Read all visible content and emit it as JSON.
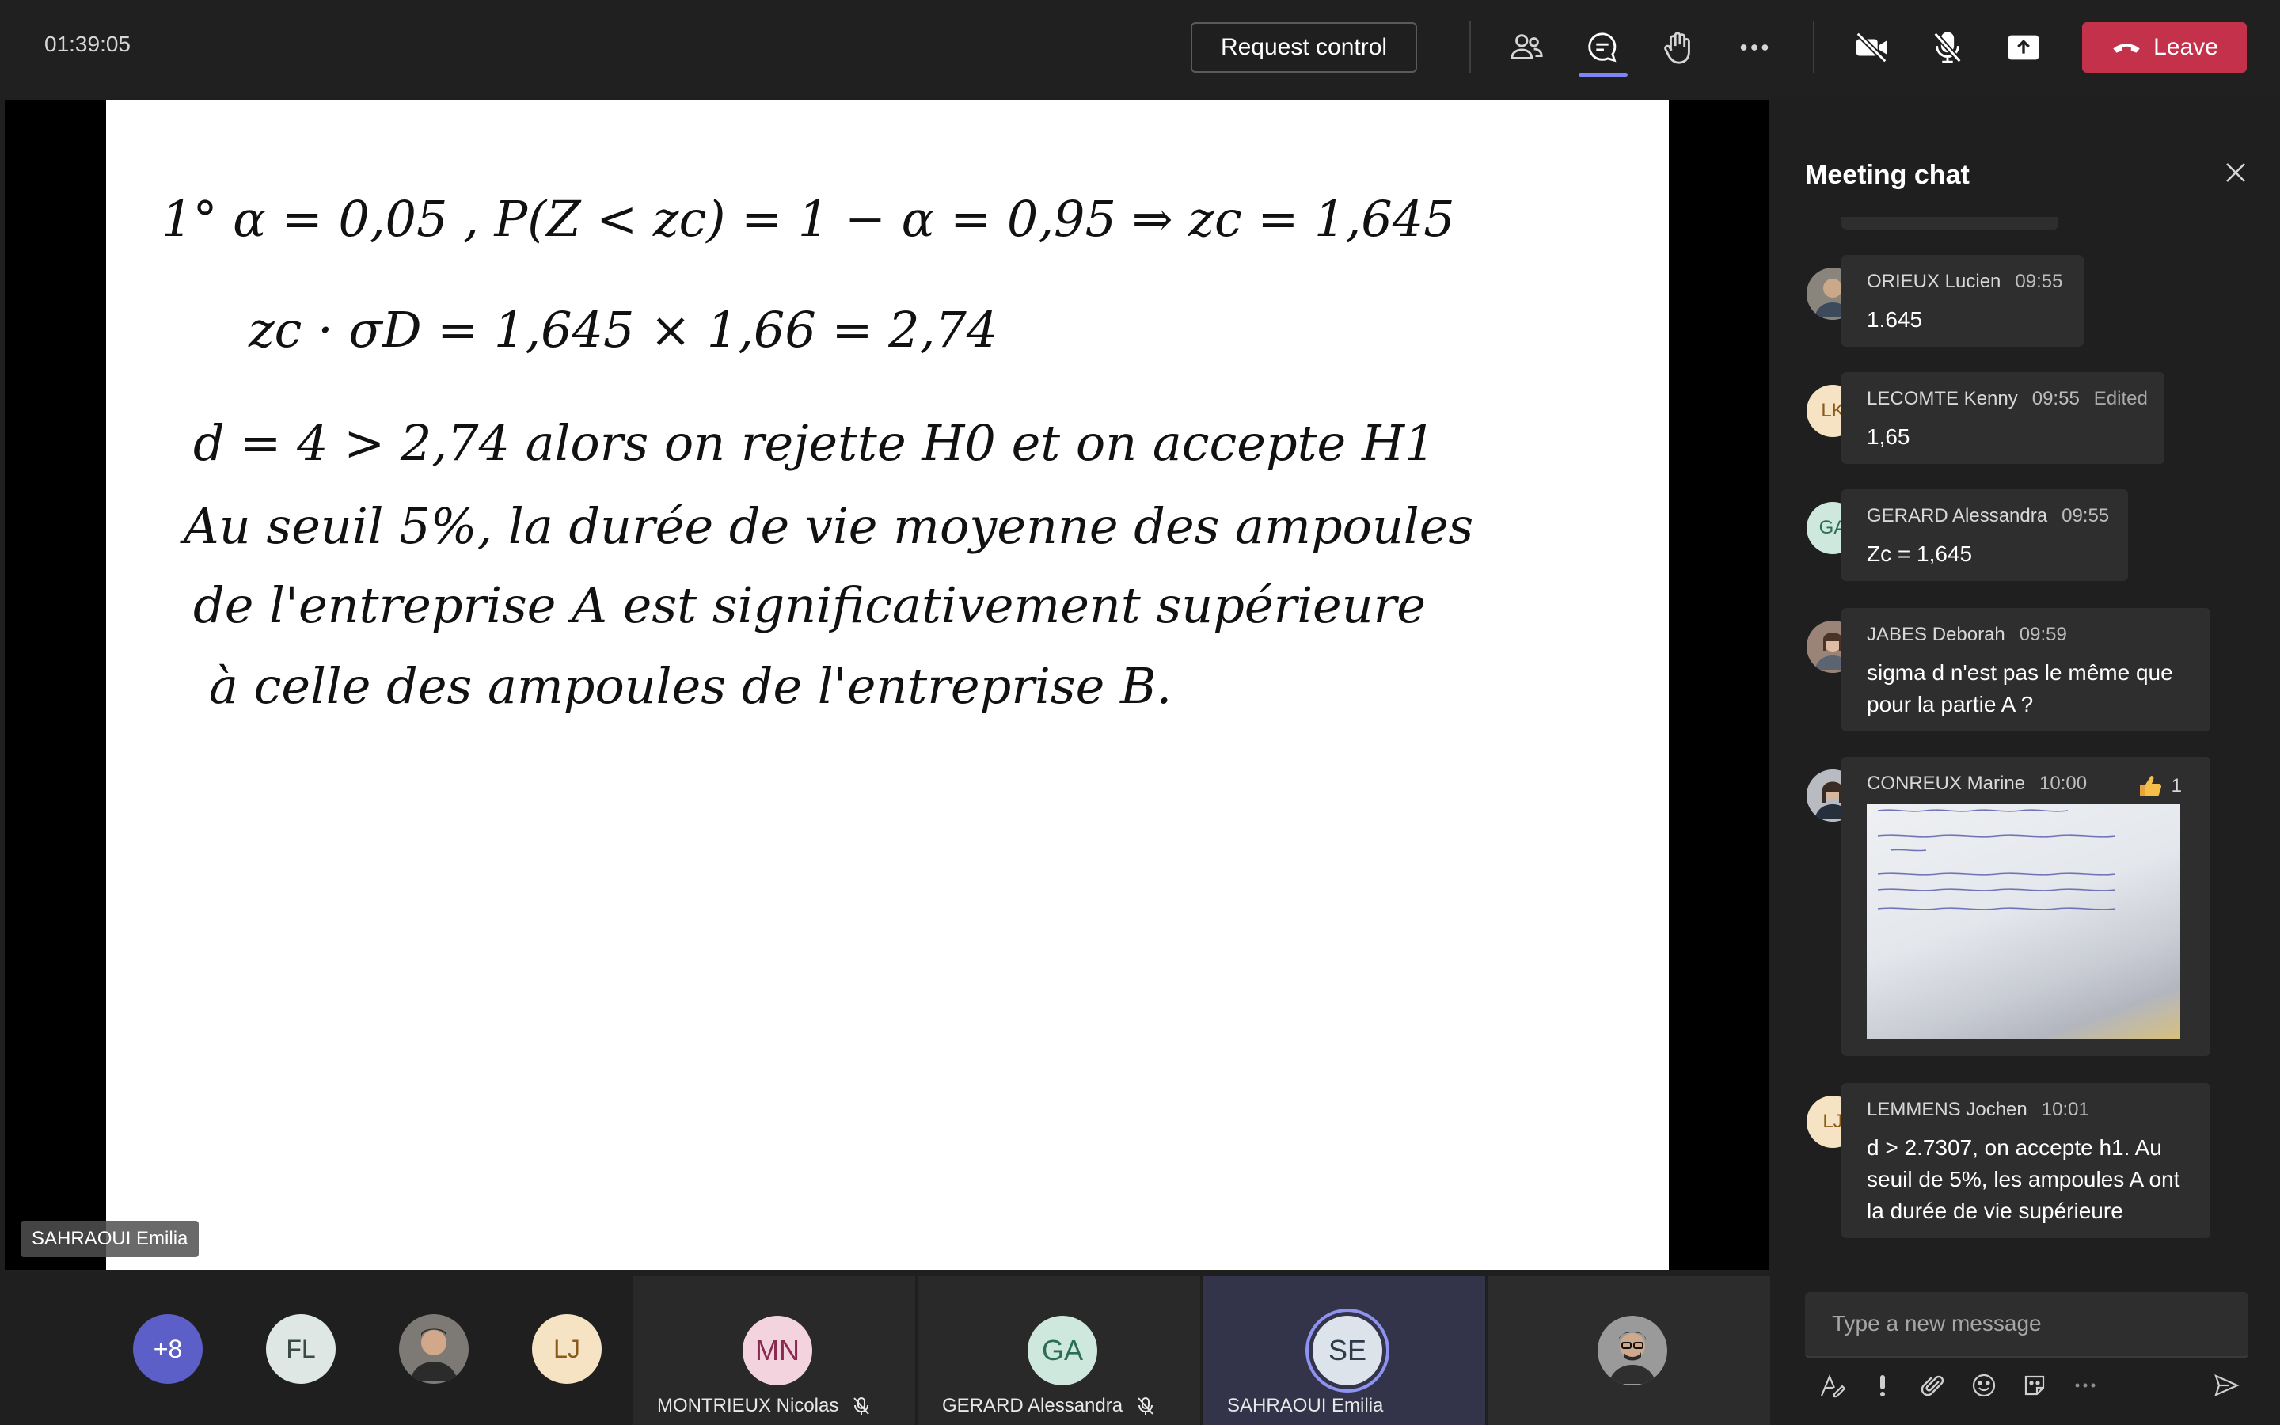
{
  "header": {
    "timer": "01:39:05",
    "request_control": "Request control",
    "leave": "Leave",
    "icons": [
      "people-icon",
      "chat-icon",
      "raise-hand-icon",
      "more-icon",
      "camera-off-icon",
      "mic-off-icon",
      "share-icon"
    ]
  },
  "stage": {
    "presenter_label": "SAHRAOUI Emilia",
    "handwriting": {
      "line1": "1° α = 0,05  ,  P(Z < zc) = 1 − α = 0,95  ⇒  zc = 1,645",
      "line2": "zc · σD = 1,645 × 1,66 = 2,74",
      "line3": "d = 4 > 2,74  alors on rejette H0 et on accepte H1",
      "line4": "Au seuil 5%, la durée de vie moyenne des ampoules",
      "line5": "de l'entreprise A est significativement supérieure",
      "line6": "à celle des ampoules de l'entreprise B."
    }
  },
  "chat": {
    "title": "Meeting chat",
    "messages": [
      {
        "sender": "ORIEUX Lucien",
        "time": "09:55",
        "text": "1.645",
        "initials": ""
      },
      {
        "sender": "LECOMTE Kenny",
        "time": "09:55",
        "edited": "Edited",
        "text": "1,65",
        "initials": "LK"
      },
      {
        "sender": "GERARD Alessandra",
        "time": "09:55",
        "text": "Zc = 1,645",
        "initials": "GA"
      },
      {
        "sender": "JABES Deborah",
        "time": "09:59",
        "text": "sigma d n'est pas le même que pour la partie A ?",
        "initials": ""
      },
      {
        "sender": "CONREUX Marine",
        "time": "10:00",
        "reaction_count": "1",
        "initials": ""
      },
      {
        "sender": "LEMMENS Jochen",
        "time": "10:01",
        "text": "d > 2.7307, on accepte h1. Au seuil de 5%, les ampoules A ont la durée de vie supérieure",
        "initials": "LJ"
      }
    ],
    "compose_placeholder": "Type a new message"
  },
  "participants": {
    "overflow": "+8",
    "small": [
      {
        "initials": "FL"
      },
      {
        "initials": ""
      },
      {
        "initials": "LJ"
      }
    ],
    "tiles": [
      {
        "initials": "MN",
        "name": "MONTRIEUX Nicolas"
      },
      {
        "initials": "GA",
        "name": "GERARD Alessandra"
      },
      {
        "initials": "SE",
        "name": "SAHRAOUI Emilia"
      }
    ]
  },
  "colors": {
    "leave": "#c4314b",
    "accent": "#7f85f5",
    "status_busy": "#c4314b",
    "status_available": "#6bb700"
  }
}
